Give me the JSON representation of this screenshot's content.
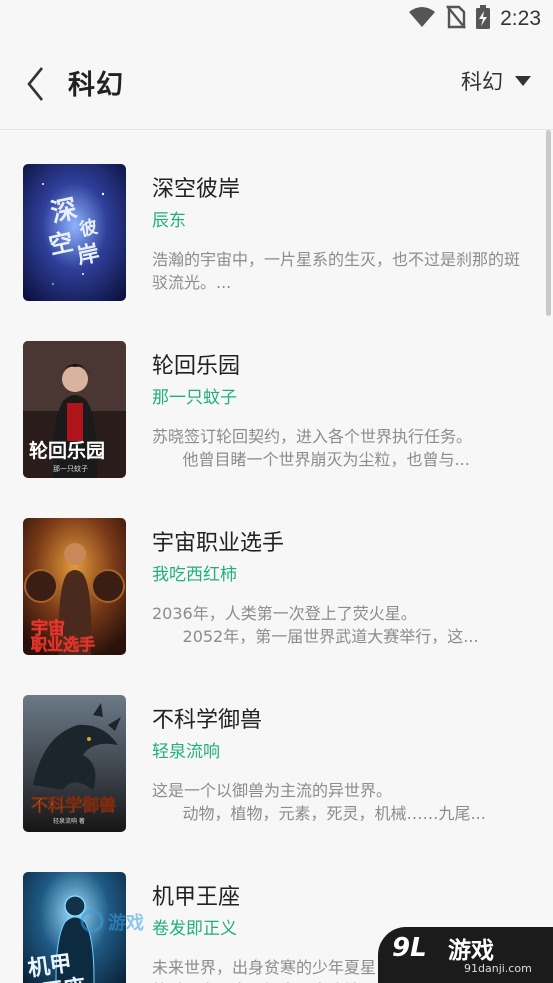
{
  "status_bar": {
    "time": "2:23",
    "icons": [
      "wifi-icon",
      "no-sim-icon",
      "battery-charging-icon"
    ]
  },
  "header": {
    "title": "科幻",
    "back_icon": "chevron-left-icon",
    "category": "科幻",
    "category_icon": "caret-down-icon"
  },
  "books": [
    {
      "title": "深空彼岸",
      "author": "辰东",
      "description": "浩瀚的宇宙中，一片星系的生灭，也不过是刹那的斑驳流光。...",
      "cover_text": "深空彼岸"
    },
    {
      "title": "轮回乐园",
      "author": "那一只蚊子",
      "description": "苏晓签订轮回契约，进入各个世界执行任务。\n      他曾目睹一个世界崩灭为尘粒，也曾与...",
      "cover_text": "轮回乐园"
    },
    {
      "title": "宇宙职业选手",
      "author": "我吃西红柿",
      "description": "2036年，人类第一次登上了荧火星。\n      2052年，第一届世界武道大赛举行，这...",
      "cover_text": "宇宙职业选手"
    },
    {
      "title": "不科学御兽",
      "author": "轻泉流响",
      "description": "这是一个以御兽为主流的异世界。\n      动物，植物，元素，死灵，机械……九尾...",
      "cover_text": "不科学御兽"
    },
    {
      "title": "机甲王座",
      "author": "卷发即正义",
      "description": "未来世界，出身贫寒的少年夏星\n放过现实，家遇埋声，身陷地...",
      "cover_text": "机甲王座"
    }
  ],
  "watermark": {
    "brand": "游戏",
    "logo_number": "9L",
    "url": "91danji.com",
    "small_text": "游戏"
  },
  "colors": {
    "accent": "#21b07a",
    "background": "#f7f7f7",
    "text": "#222222",
    "muted": "#8c8c8c"
  }
}
